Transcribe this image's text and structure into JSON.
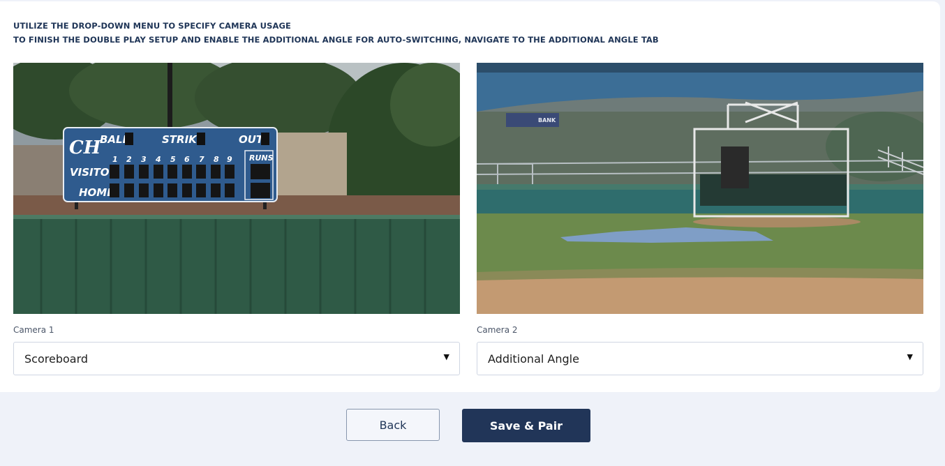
{
  "instructions": {
    "line1": "UTILIZE THE DROP-DOWN MENU TO SPECIFY CAMERA USAGE",
    "line2": "TO FINISH THE DOUBLE PLAY SETUP AND ENABLE THE ADDITIONAL ANGLE FOR AUTO-SWITCHING, NAVIGATE TO THE ADDITIONAL ANGLE TAB"
  },
  "cameras": [
    {
      "label": "Camera 1",
      "selected": "Scoreboard",
      "preview": "scoreboard-feed",
      "scoreboard": {
        "logo": "CH",
        "ball": "BALL",
        "strike": "STRIKE",
        "out": "OUT",
        "visitor": "VISITOR",
        "home": "HOME",
        "runs": "RUNS",
        "innings": [
          "1",
          "2",
          "3",
          "4",
          "5",
          "6",
          "7",
          "8",
          "9"
        ]
      }
    },
    {
      "label": "Camera 2",
      "selected": "Additional Angle",
      "preview": "field-feed",
      "sign_text": "BANK"
    }
  ],
  "buttons": {
    "back": "Back",
    "save": "Save & Pair"
  },
  "colors": {
    "primary": "#213558",
    "background": "#eff2f9",
    "scoreboard_blue": "#2f5b8e"
  },
  "icons": {
    "dropdown": "caret-down-icon"
  }
}
